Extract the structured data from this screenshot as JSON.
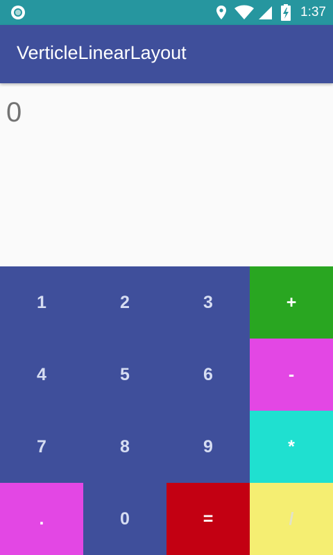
{
  "status_bar": {
    "left_icon": "circle-notification-icon",
    "icons": [
      "location-icon",
      "wifi-icon",
      "signal-icon",
      "battery-icon"
    ],
    "time": "1:37",
    "background": "#26969f"
  },
  "app_bar": {
    "title": "VerticleLinearLayout",
    "background": "#3f4f9b"
  },
  "display": {
    "value": "0"
  },
  "keypad": {
    "digit_color": "#3f4f9b",
    "keys": [
      {
        "label": "1",
        "color": "#3f4f9b"
      },
      {
        "label": "2",
        "color": "#3f4f9b"
      },
      {
        "label": "3",
        "color": "#3f4f9b"
      },
      {
        "label": "+",
        "color": "#29a621"
      },
      {
        "label": "4",
        "color": "#3f4f9b"
      },
      {
        "label": "5",
        "color": "#3f4f9b"
      },
      {
        "label": "6",
        "color": "#3f4f9b"
      },
      {
        "label": "-",
        "color": "#e347e4"
      },
      {
        "label": "7",
        "color": "#3f4f9b"
      },
      {
        "label": "8",
        "color": "#3f4f9b"
      },
      {
        "label": "9",
        "color": "#3f4f9b"
      },
      {
        "label": "*",
        "color": "#1fe0d0"
      },
      {
        "label": ".",
        "color": "#e347e4"
      },
      {
        "label": "0",
        "color": "#3f4f9b"
      },
      {
        "label": "=",
        "color": "#c30012"
      },
      {
        "label": "/",
        "color": "#f5ee72"
      }
    ]
  }
}
